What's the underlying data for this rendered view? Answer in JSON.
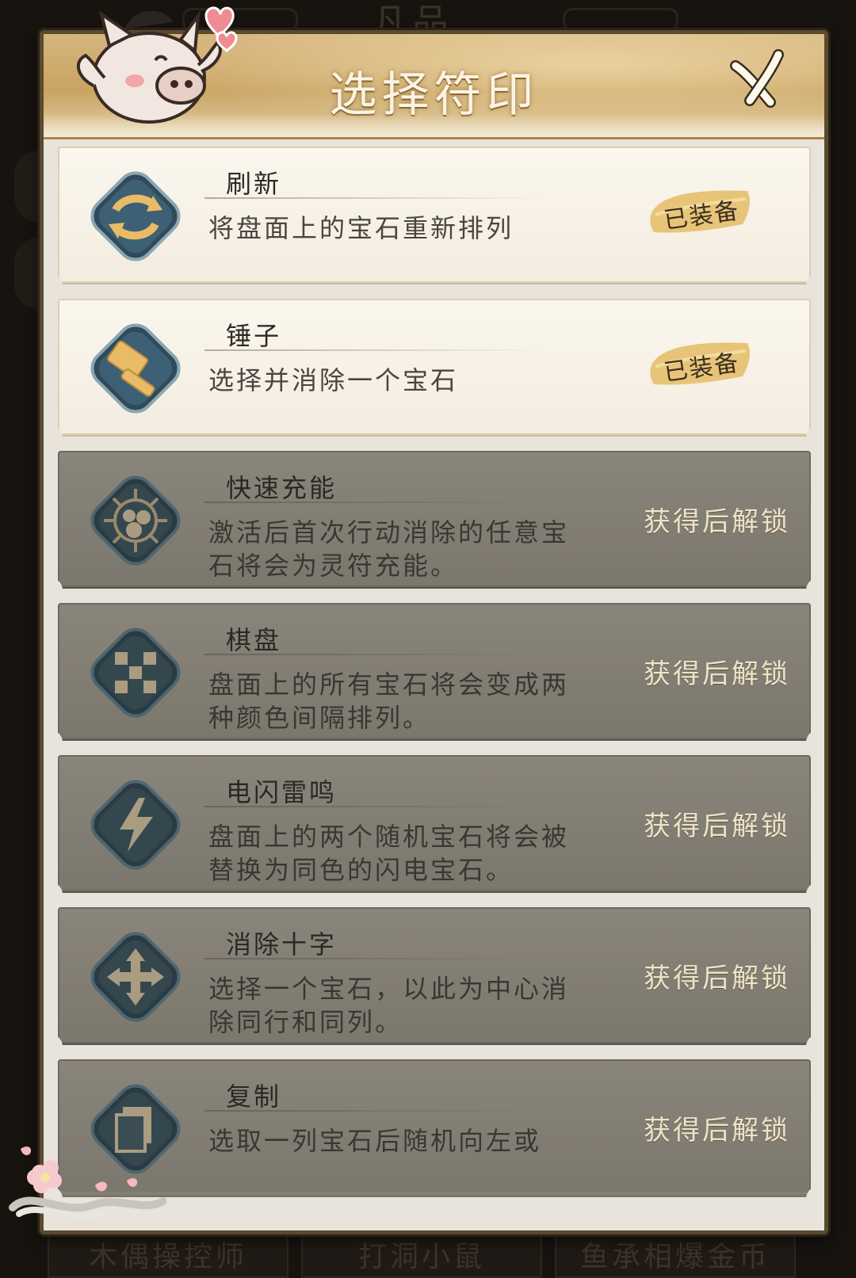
{
  "background": {
    "top_text": "凡品",
    "bottom_tabs": [
      "木偶操控师",
      "打洞小鼠",
      "鱼承相爆金币"
    ]
  },
  "panel": {
    "title": "选择符印",
    "close_icon": "close-x-icon"
  },
  "items": [
    {
      "name": "刷新",
      "desc": "将盘面上的宝石重新排列",
      "status": "已装备",
      "state": "equipped",
      "icon": "refresh-icon"
    },
    {
      "name": "锤子",
      "desc": "选择并消除一个宝石",
      "status": "已装备",
      "state": "equipped",
      "icon": "hammer-icon"
    },
    {
      "name": "快速充能",
      "desc": "激活后首次行动消除的任意宝石将会为灵符充能。",
      "status": "获得后解锁",
      "state": "locked",
      "icon": "spiky-orbs-icon"
    },
    {
      "name": "棋盘",
      "desc": "盘面上的所有宝石将会变成两种颜色间隔排列。",
      "status": "获得后解锁",
      "state": "locked",
      "icon": "checkerboard-icon"
    },
    {
      "name": "电闪雷鸣",
      "desc": "盘面上的两个随机宝石将会被替换为同色的闪电宝石。",
      "status": "获得后解锁",
      "state": "locked",
      "icon": "lightning-icon"
    },
    {
      "name": "消除十字",
      "desc": "选择一个宝石，以此为中心消除同行和同列。",
      "status": "获得后解锁",
      "state": "locked",
      "icon": "cross-arrows-icon"
    },
    {
      "name": "复制",
      "desc": "选取一列宝石后随机向左或",
      "status": "获得后解锁",
      "state": "locked",
      "icon": "copy-icon"
    }
  ],
  "colors": {
    "equipped_bg": "#f7f1e6",
    "locked_bg": "#837e74",
    "icon_blue": "#3a5a6e",
    "icon_gold": "#e2b868"
  }
}
